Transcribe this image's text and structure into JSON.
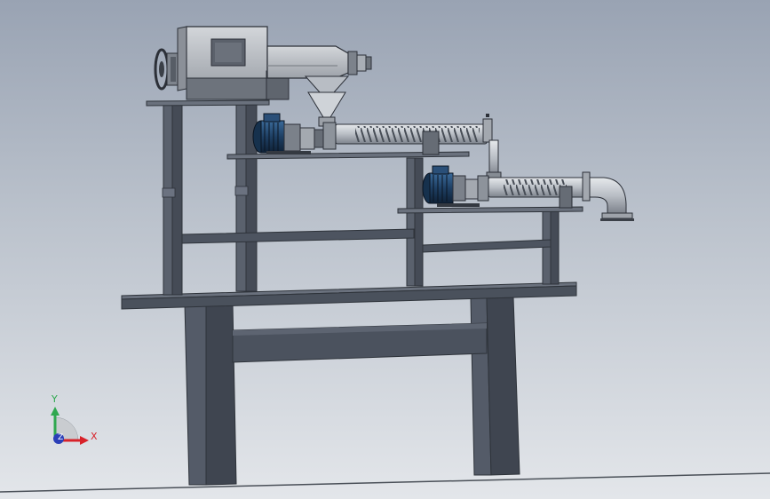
{
  "viewport": {
    "background_top": "#99a3b3",
    "background_bottom": "#e3e6ea"
  },
  "triad": {
    "x_label": "X",
    "y_label": "Y",
    "z_label": "Z",
    "x_color": "#d8222a",
    "y_color": "#2fa84f",
    "z_color": "#2b3fb8"
  },
  "model": {
    "frame_color": "#545b68",
    "frame_dark": "#3c424c",
    "steel_light": "#c8ccd2",
    "motor_color": "#1e3f63",
    "components": [
      "feed-screw-conveyor",
      "hopper",
      "upper-motor",
      "upper-screw-conveyor",
      "lower-motor",
      "lower-screw-conveyor",
      "outlet-elbow",
      "support-frame"
    ]
  }
}
